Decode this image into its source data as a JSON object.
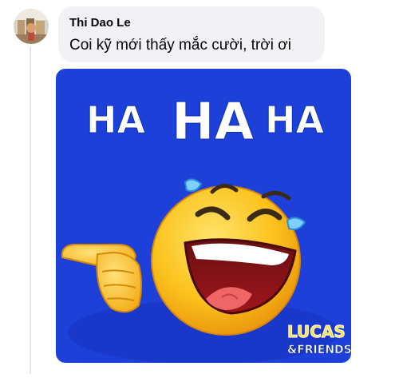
{
  "comment": {
    "author": "Thi Dao Le",
    "text": "Coi kỹ mới thấy mắc cười, trời ơi"
  },
  "sticker": {
    "headline_small_1": "HA",
    "headline_big": "HA",
    "headline_small_2": "HA",
    "brand_line_1": "LUCAS",
    "brand_line_2": "&FRIENDS",
    "background_color": "#1c40d8",
    "face_color": "#fbc21c"
  },
  "actions": {
    "like_label": "",
    "reply_label": "",
    "share_label": ""
  },
  "colors": {
    "bubble_bg": "#f0f2f5",
    "text": "#050505",
    "muted": "#65676b"
  }
}
